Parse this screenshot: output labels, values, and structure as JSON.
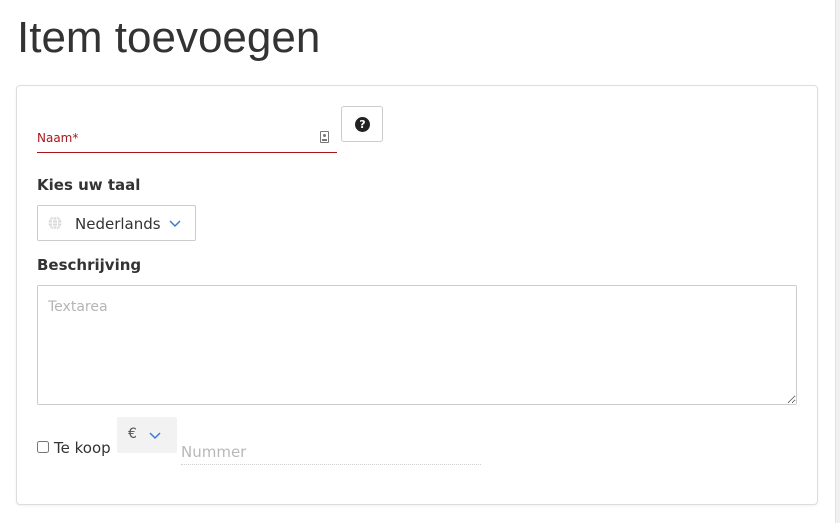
{
  "page": {
    "title": "Item toevoegen"
  },
  "form": {
    "name": {
      "label": "Naam*",
      "value": "",
      "icon": "id-card-icon",
      "accent_color": "#a8161b"
    },
    "help": {
      "icon": "question-circle-icon",
      "symbol": "?"
    },
    "language": {
      "heading": "Kies uw taal",
      "selected": "Nederlands",
      "icon": "globe-icon",
      "chevron_color": "#3a7bd5"
    },
    "description": {
      "heading": "Beschrijving",
      "placeholder": "Textarea",
      "value": ""
    },
    "sale": {
      "checkbox_label": "Te koop",
      "checked": false,
      "currency": "€",
      "price_placeholder": "Nummer",
      "price_value": ""
    }
  }
}
